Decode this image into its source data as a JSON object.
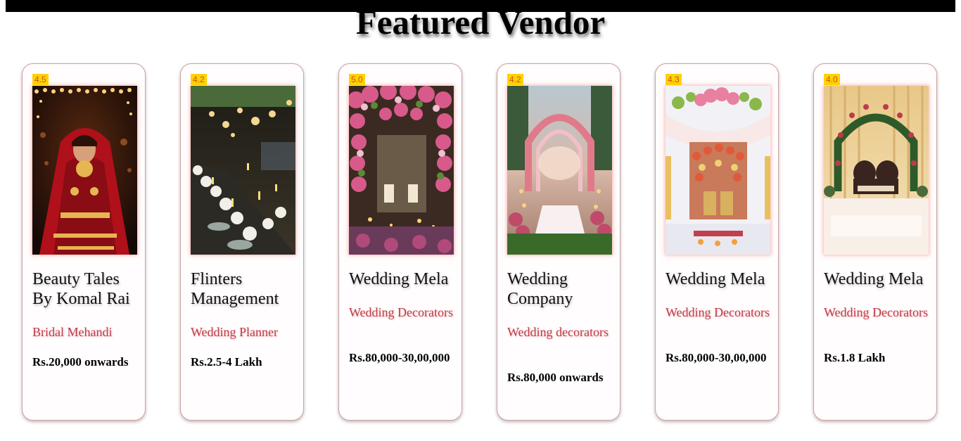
{
  "page": {
    "title": "Featured Vendor"
  },
  "colors": {
    "rating_bg": "#ffd200",
    "rating_text": "#d05020",
    "category_text": "#c03b48",
    "card_border": "#caa4a4",
    "topbar": "#000000"
  },
  "vendors": [
    {
      "rating": "4.5",
      "name": "Beauty Tales By Komal Rai",
      "category": "Bridal Mehandi",
      "price": "Rs.20,000 onwards",
      "image": "bride-photo"
    },
    {
      "rating": "4.2",
      "name": "Flinters Management",
      "category": "Wedding Planner",
      "price": "Rs.2.5-4 Lakh",
      "image": "banquet-table-photo"
    },
    {
      "rating": "5.0",
      "name": "Wedding Mela",
      "category": "Wedding Decorators",
      "price": "Rs.80,000-30,00,000",
      "image": "floral-mandap-photo"
    },
    {
      "rating": "4.2",
      "name": "Wedding Company",
      "category": "Wedding decorators",
      "price": "Rs.80,000 onwards",
      "image": "floral-arch-aisle-photo"
    },
    {
      "rating": "4.3",
      "name": "Wedding Mela",
      "category": "Wedding Decorators",
      "price": "Rs.80,000-30,00,000",
      "image": "stage-decor-photo"
    },
    {
      "rating": "4.0",
      "name": "Wedding Mela",
      "category": "Wedding Decorators",
      "price": "Rs.1.8 Lakh",
      "image": "flower-arch-sofa-photo"
    }
  ]
}
